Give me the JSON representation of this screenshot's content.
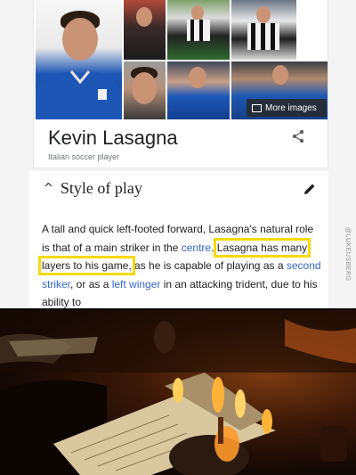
{
  "knowledge_panel": {
    "name": "Kevin Lasagna",
    "subtitle": "Italian soccer player",
    "more_images_label": "More images"
  },
  "wiki_section": {
    "title": "Style of play",
    "paragraph": {
      "p1": "A tall and quick left-footed forward, Lasagna's natural role is that of a main striker in the ",
      "link_centre": "centre",
      "p2": ". ",
      "highlighted": "Lasagna has many layers to his game,",
      "p3": " as he is capable of playing as a ",
      "link_second_striker": "second striker",
      "p4": ", or as a ",
      "link_left_winger": "left winger",
      "p5": " in an attacking trident, due to his ability to"
    }
  },
  "watermark": "@LUKEUSBERG",
  "colors": {
    "link": "#3366cc",
    "highlight": "#f5d90a",
    "jersey": "#1d56b5"
  },
  "icons": [
    "share-icon",
    "edit-pencil-icon",
    "collapse-caret-icon",
    "image-icon"
  ]
}
